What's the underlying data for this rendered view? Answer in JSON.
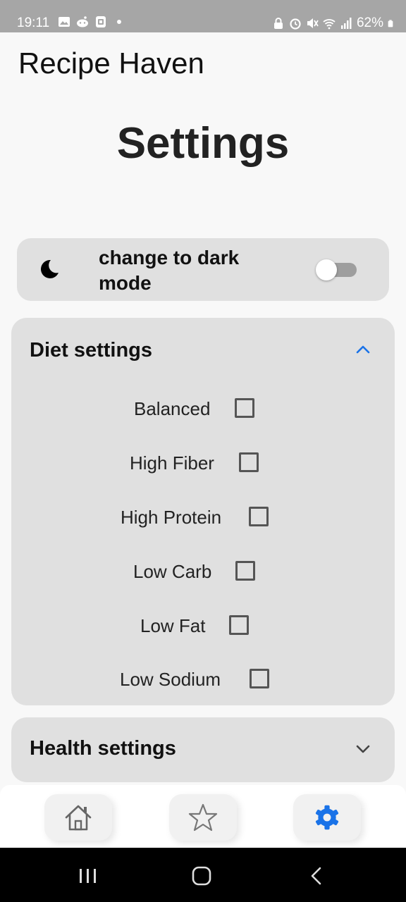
{
  "status_bar": {
    "time": "19:11",
    "battery": "62%",
    "left_icons": [
      "gallery-icon",
      "reddit-icon",
      "screenshot-icon",
      "dot-icon"
    ],
    "right_icons": [
      "lock-icon",
      "alarm-icon",
      "mute-icon",
      "wifi-icon",
      "signal-icon",
      "battery-icon"
    ]
  },
  "app": {
    "title": "Recipe Haven"
  },
  "page": {
    "title": "Settings"
  },
  "dark_mode": {
    "label": "change to dark mode",
    "enabled": false,
    "icon": "moon-icon"
  },
  "diet": {
    "title": "Diet settings",
    "expanded": true,
    "options": [
      {
        "label": "Balanced",
        "checked": false
      },
      {
        "label": "High Fiber",
        "checked": false
      },
      {
        "label": "High Protein",
        "checked": false
      },
      {
        "label": "Low Carb",
        "checked": false
      },
      {
        "label": "Low Fat",
        "checked": false
      },
      {
        "label": "Low Sodium",
        "checked": false
      }
    ]
  },
  "health": {
    "title": "Health settings",
    "expanded": false
  },
  "bottom_nav": {
    "items": [
      {
        "name": "home",
        "icon": "home-icon",
        "active": false
      },
      {
        "name": "favorites",
        "icon": "star-icon",
        "active": false
      },
      {
        "name": "settings",
        "icon": "gear-icon",
        "active": true
      }
    ]
  },
  "colors": {
    "accent": "#1a73e8",
    "card": "#e0e0e0",
    "background": "#f8f8f8",
    "status_bar": "#a6a6a6"
  }
}
